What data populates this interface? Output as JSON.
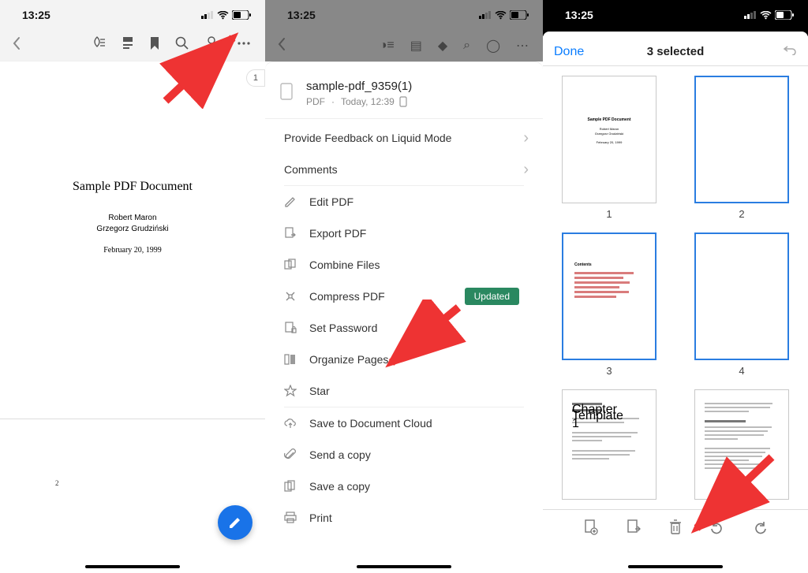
{
  "status": {
    "time": "13:25"
  },
  "pane1": {
    "page_pill": "1",
    "doc_title": "Sample PDF Document",
    "author1": "Robert Maron",
    "author2": "Grzegorz Grudziński",
    "date": "February 20, 1999",
    "page2_num": "2"
  },
  "pane2": {
    "file": {
      "name": "sample-pdf_9359(1)",
      "type": "PDF",
      "when": "Today, 12:39"
    },
    "rows": {
      "feedback": "Provide Feedback on Liquid Mode",
      "comments": "Comments",
      "edit": "Edit PDF",
      "export": "Export PDF",
      "combine": "Combine Files",
      "compress": "Compress PDF",
      "compress_badge": "Updated",
      "password": "Set Password",
      "organize": "Organize Pages",
      "star": "Star",
      "save_cloud": "Save to Document Cloud",
      "send_copy": "Send a copy",
      "save_copy": "Save a copy",
      "print": "Print"
    }
  },
  "pane3": {
    "done": "Done",
    "title": "3 selected",
    "thumbs": {
      "n1": "1",
      "n2": "2",
      "n3": "3",
      "n4": "4",
      "t1_title": "Sample PDF Document",
      "t3_contents": "Contents",
      "t5_chap": "Chapter 1",
      "t5_tpl": "Template"
    }
  }
}
